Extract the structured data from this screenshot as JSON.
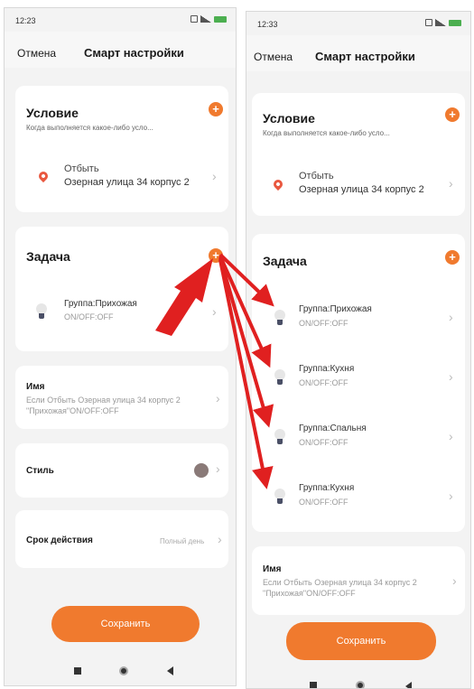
{
  "left": {
    "status": {
      "time": "12:23"
    },
    "nav": {
      "cancel": "Отмена",
      "title": "Смарт настройки"
    },
    "condition": {
      "title": "Условие",
      "subtitle": "Когда выполняется какое-либо усло...",
      "location_action": "Отбыть",
      "location_address": "Озерная улица 34 корпус 2"
    },
    "task": {
      "title": "Задача",
      "items": [
        {
          "name": "Группа:Прихожая",
          "state": "ON/OFF:OFF"
        }
      ]
    },
    "name_row": {
      "label": "Имя",
      "line1": "Если Отбыть Озерная улица 34 корпус 2",
      "line2": "\"Прихожая\"ON/OFF:OFF"
    },
    "style_row": {
      "label": "Стиль",
      "color": "#8a7a78"
    },
    "validity_row": {
      "label": "Срок действия",
      "value": "Полный день"
    },
    "save_label": "Сохранить"
  },
  "right": {
    "status": {
      "time": "12:33"
    },
    "nav": {
      "cancel": "Отмена",
      "title": "Смарт настройки"
    },
    "condition": {
      "title": "Условие",
      "subtitle": "Когда выполняется какое-либо усло...",
      "location_action": "Отбыть",
      "location_address": "Озерная улица 34 корпус 2"
    },
    "task": {
      "title": "Задача",
      "items": [
        {
          "name": "Группа:Прихожая",
          "state": "ON/OFF:OFF"
        },
        {
          "name": "Группа:Кухня",
          "state": "ON/OFF:OFF"
        },
        {
          "name": "Группа:Спальня",
          "state": "ON/OFF:OFF"
        },
        {
          "name": "Группа:Кухня",
          "state": "ON/OFF:OFF"
        }
      ]
    },
    "name_row": {
      "label": "Имя",
      "line1": "Если Отбыть Озерная улица 34 корпус 2",
      "line2": "\"Прихожая\"ON/OFF:OFF"
    },
    "save_label": "Сохранить"
  },
  "colors": {
    "accent": "#f07a2e",
    "annotation_arrows": "#e02020",
    "pin": "#e9573f"
  }
}
